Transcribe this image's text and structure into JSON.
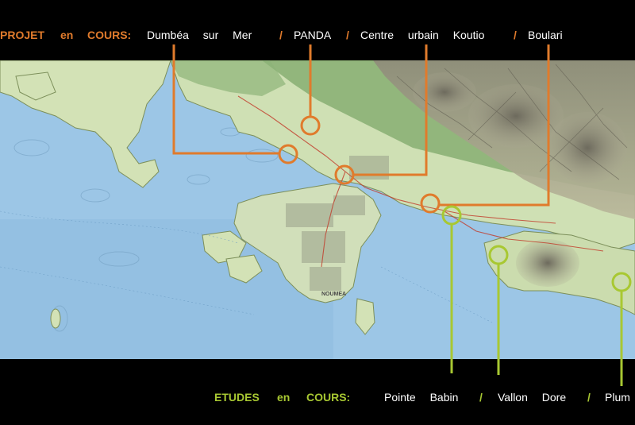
{
  "colors": {
    "projet": "#e07b2c",
    "etudes": "#a8c832",
    "sea": "#9cc6e6",
    "land": "#cfe0b4",
    "forest": "#6f9e5e",
    "mountain": "#8d8a78"
  },
  "header": {
    "title_word1": "PROJET",
    "title_word2": "en",
    "title_word3": "COURS:",
    "items": [
      {
        "label": "Dumbéa sur Mer",
        "sep": "/"
      },
      {
        "label": "PANDA",
        "sep": "/"
      },
      {
        "label": "Centre urbain Koutio",
        "sep": "/"
      },
      {
        "label": "Boulari",
        "sep": ""
      }
    ]
  },
  "footer": {
    "title_word1": "ETUDES",
    "title_word2": "en",
    "title_word3": "COURS:",
    "items": [
      {
        "label": "Pointe Babin",
        "sep": "/"
      },
      {
        "label": "Vallon Dore",
        "sep": "/"
      },
      {
        "label": "Plum",
        "sep": ""
      }
    ]
  },
  "map": {
    "place_label": "NOUMEA",
    "markers_projet": [
      {
        "name": "Dumbéa sur Mer"
      },
      {
        "name": "PANDA"
      },
      {
        "name": "Centre urbain Koutio"
      },
      {
        "name": "Boulari"
      }
    ],
    "markers_etudes": [
      {
        "name": "Pointe Babin"
      },
      {
        "name": "Vallon Dore"
      },
      {
        "name": "Plum"
      }
    ]
  }
}
